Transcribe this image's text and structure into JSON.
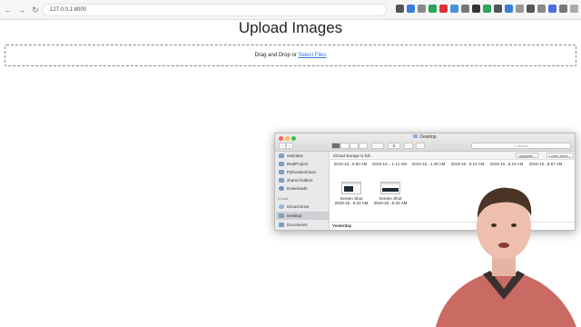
{
  "browser": {
    "url": "127.0.0.1:8000",
    "nav_back": "←",
    "nav_forward": "→",
    "nav_reload": "↻"
  },
  "page": {
    "title": "Upload Images",
    "dropzone_text": "Drag and Drop or ",
    "select_files_link": "Select Files"
  },
  "finder": {
    "window_title": "Desktop",
    "search_placeholder": "Search",
    "storage_message": "iCloud storage is full.",
    "upgrade_button": "Upgrade...",
    "learn_more_button": "Learn More...",
    "sidebar": {
      "items_top": [
        "realclass",
        "RealProject",
        "PythonBotClass",
        "shared folders",
        "Downloads"
      ],
      "icloud_header": "iCloud",
      "items_icloud": [
        "iCloud Drive",
        "Desktop",
        "Documents"
      ]
    },
    "top_dates": [
      "2019-10...0.50 AM",
      "2019-10....1.14 AM",
      "2019-10...1.49 AM",
      "2019-10...8.14 AM",
      "2019-10...8.15 AM",
      "2019-10...8.57 AM"
    ],
    "files": [
      {
        "name": "Screen Shot",
        "date": "2019-10...9.22 AM"
      },
      {
        "name": "Screen Shot",
        "date": "2019-10...9.42 AM"
      }
    ],
    "section_yesterday": "Yesterday"
  },
  "colors": {
    "link": "#2a7ae2",
    "traffic_red": "#fc605c",
    "traffic_yellow": "#fdbc40",
    "traffic_green": "#34c84a"
  }
}
